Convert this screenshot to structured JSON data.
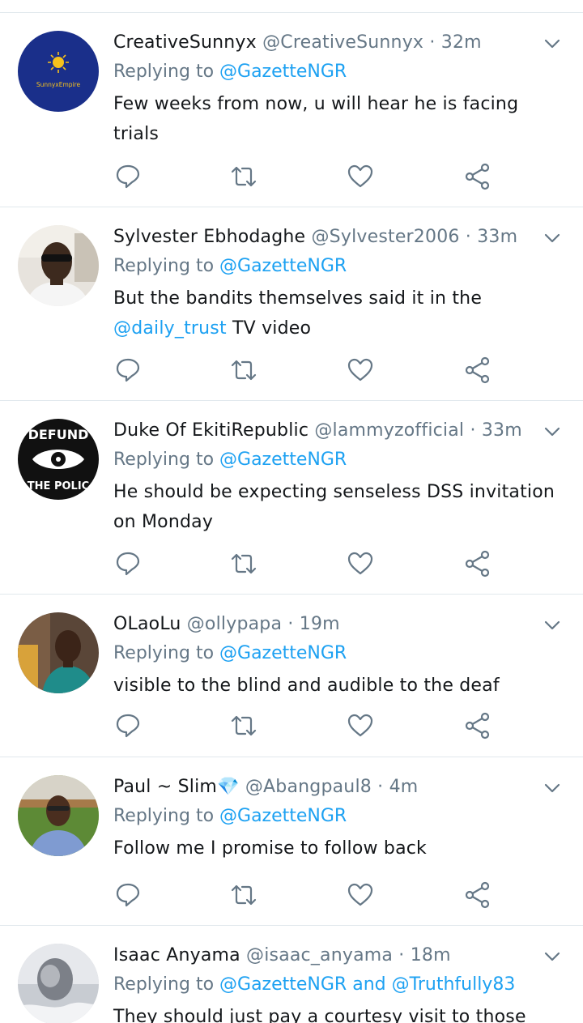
{
  "tweets": [
    {
      "name": "CreativeSunnyx",
      "handle": "@CreativeSunnyx",
      "separator": "·",
      "time": "32m",
      "replying_prefix": "Replying to",
      "replying_to": "@GazetteNGR",
      "text": "Few weeks from now, u will hear he is facing trials",
      "avatar_label": "SunnyxEmpire"
    },
    {
      "name": "Sylvester Ebhodaghe",
      "handle": "@Sylvester2006",
      "separator": "·",
      "time": "33m",
      "replying_prefix": "Replying to",
      "replying_to": "@GazetteNGR",
      "text_before": "But the bandits themselves said it in the",
      "text_mention": "@daily_trust",
      "text_after": "TV video"
    },
    {
      "name": "Duke Of EkitiRepublic",
      "handle": "@lammyzofficial",
      "separator": "·",
      "time": "33m",
      "replying_prefix": "Replying to",
      "replying_to": "@GazetteNGR",
      "text": "He should be expecting senseless DSS invitation on Monday",
      "avatar_top": "DEFUND",
      "avatar_bottom": "THE POLIC"
    },
    {
      "name": "OLaoLu",
      "handle": "@ollypapa",
      "separator": "·",
      "time": "19m",
      "replying_prefix": "Replying to",
      "replying_to": "@GazetteNGR",
      "text": "visible to the blind and audible to the deaf"
    },
    {
      "name": "Paul ~ Slim💎",
      "handle": "@Abangpaul8",
      "separator": "·",
      "time": "4m",
      "replying_prefix": "Replying to",
      "replying_to": "@GazetteNGR",
      "text": "Follow me I promise to follow back"
    },
    {
      "name": "Isaac Anyama",
      "handle": "@isaac_anyama",
      "separator": "·",
      "time": "18m",
      "replying_prefix": "Replying to",
      "replying_to": "@GazetteNGR",
      "replying_and": "and",
      "replying_to_2": "@Truthfully83",
      "text": "They should just pay a courtesy visit to those"
    }
  ],
  "icons": {
    "reply": "reply-icon",
    "retweet": "retweet-icon",
    "like": "heart-icon",
    "share": "share-icon",
    "caret": "chevron-down-icon"
  },
  "colors": {
    "link": "#1da1f2",
    "muted": "#657786",
    "text": "#14171a",
    "divider": "#e1e8ed"
  }
}
